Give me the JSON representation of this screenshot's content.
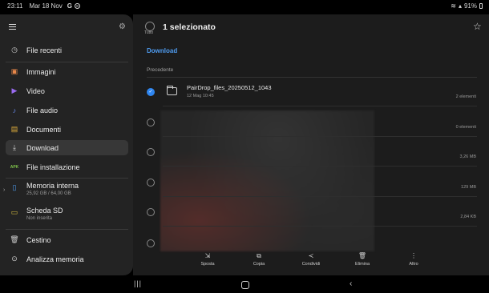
{
  "status": {
    "time": "23:11",
    "date": "Mar 18 Nov",
    "battery": "91%"
  },
  "sidebar": {
    "items": [
      {
        "label": "File recenti",
        "icon": "clock-icon",
        "color": "#cfcfcf"
      },
      {
        "label": "Immagini",
        "icon": "image-icon",
        "color": "#e8884a"
      },
      {
        "label": "Video",
        "icon": "video-icon",
        "color": "#9a6bf0"
      },
      {
        "label": "File audio",
        "icon": "music-icon",
        "color": "#6a8cf0"
      },
      {
        "label": "Documenti",
        "icon": "document-icon",
        "color": "#e6b23c"
      },
      {
        "label": "Download",
        "icon": "download-icon",
        "color": "#cfcfcf"
      },
      {
        "label": "File installazione",
        "icon": "apk-icon",
        "color": "#7fc24a"
      },
      {
        "label": "Memoria interna",
        "sub": "25,92 GB / 64,00 GB",
        "icon": "phone-icon",
        "color": "#4f9cf0"
      },
      {
        "label": "Scheda SD",
        "sub": "Non inserita",
        "icon": "sdcard-icon",
        "color": "#d9c040"
      },
      {
        "label": "Cestino",
        "icon": "trash-icon",
        "color": "#cfcfcf"
      },
      {
        "label": "Analizza memoria",
        "icon": "analyze-icon",
        "color": "#cfcfcf"
      }
    ],
    "apk_text": "APK"
  },
  "header": {
    "select_all": "Tutto",
    "title": "1 selezionato"
  },
  "breadcrumb": "Download",
  "section": "Precedente",
  "rows": [
    {
      "name": "PairDrop_files_20250512_1043",
      "date": "12 Mag 10:45",
      "meta": "2 elementi",
      "checked": true
    },
    {
      "meta": "0 elementi"
    },
    {
      "meta": "3,26 MB"
    },
    {
      "meta": "129 MB"
    },
    {
      "meta": "2,84 KB"
    }
  ],
  "toolbar": {
    "move": "Sposta",
    "copy": "Copia",
    "share": "Condividi",
    "delete": "Elimina",
    "more": "Altro"
  },
  "colors": {
    "accent": "#2f86f0",
    "link": "#4f9cf0"
  }
}
